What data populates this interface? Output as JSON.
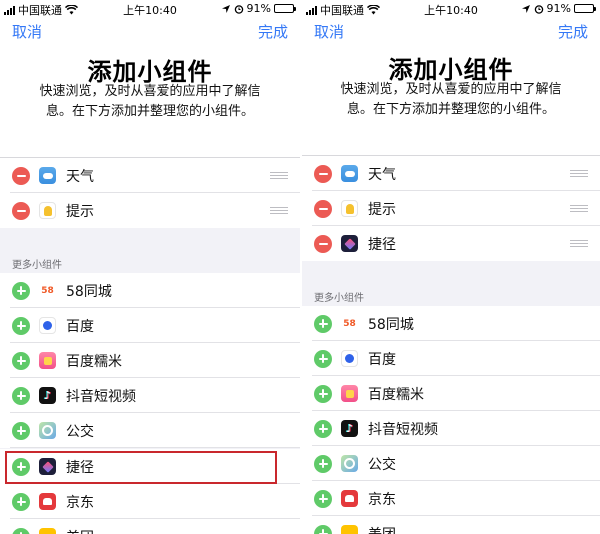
{
  "status_bar": {
    "carrier": "中国联通",
    "time": "上午10:40",
    "battery": "91%",
    "battery_level": 0.91
  },
  "nav": {
    "cancel_label": "取消",
    "done_label": "完成"
  },
  "header": {
    "title": "添加小组件",
    "description_line1": "快速浏览，及时从喜爱的应用中了解信",
    "description_line2": "息。在下方添加并整理您的小组件。"
  },
  "more_widgets_label": "更多小组件",
  "left_screen": {
    "active_widgets": [
      {
        "label": "天气",
        "icon": "weather-icon"
      },
      {
        "label": "提示",
        "icon": "reminders-icon"
      }
    ],
    "more_widgets": [
      {
        "label": "58同城",
        "icon": "58-tongcheng-icon",
        "icon_text": "58"
      },
      {
        "label": "百度",
        "icon": "baidu-icon"
      },
      {
        "label": "百度糯米",
        "icon": "baidu-nuomi-icon"
      },
      {
        "label": "抖音短视频",
        "icon": "douyin-icon"
      },
      {
        "label": "公交",
        "icon": "bus-icon"
      },
      {
        "label": "捷径",
        "icon": "shortcuts-icon",
        "highlighted": true
      },
      {
        "label": "京东",
        "icon": "jd-icon"
      },
      {
        "label": "美团",
        "icon": "meituan-icon"
      }
    ]
  },
  "right_screen": {
    "active_widgets": [
      {
        "label": "天气",
        "icon": "weather-icon"
      },
      {
        "label": "提示",
        "icon": "reminders-icon"
      },
      {
        "label": "捷径",
        "icon": "shortcuts-icon"
      }
    ],
    "more_widgets": [
      {
        "label": "58同城",
        "icon": "58-tongcheng-icon",
        "icon_text": "58"
      },
      {
        "label": "百度",
        "icon": "baidu-icon"
      },
      {
        "label": "百度糯米",
        "icon": "baidu-nuomi-icon"
      },
      {
        "label": "抖音短视频",
        "icon": "douyin-icon"
      },
      {
        "label": "公交",
        "icon": "bus-icon"
      },
      {
        "label": "京东",
        "icon": "jd-icon"
      },
      {
        "label": "美团",
        "icon": "meituan-icon"
      }
    ]
  },
  "colors": {
    "accent": "#3478f6",
    "remove": "#ec5a54",
    "add": "#5fca68",
    "highlight_box": "#c9282d",
    "group_background": "#f2f2f7"
  }
}
